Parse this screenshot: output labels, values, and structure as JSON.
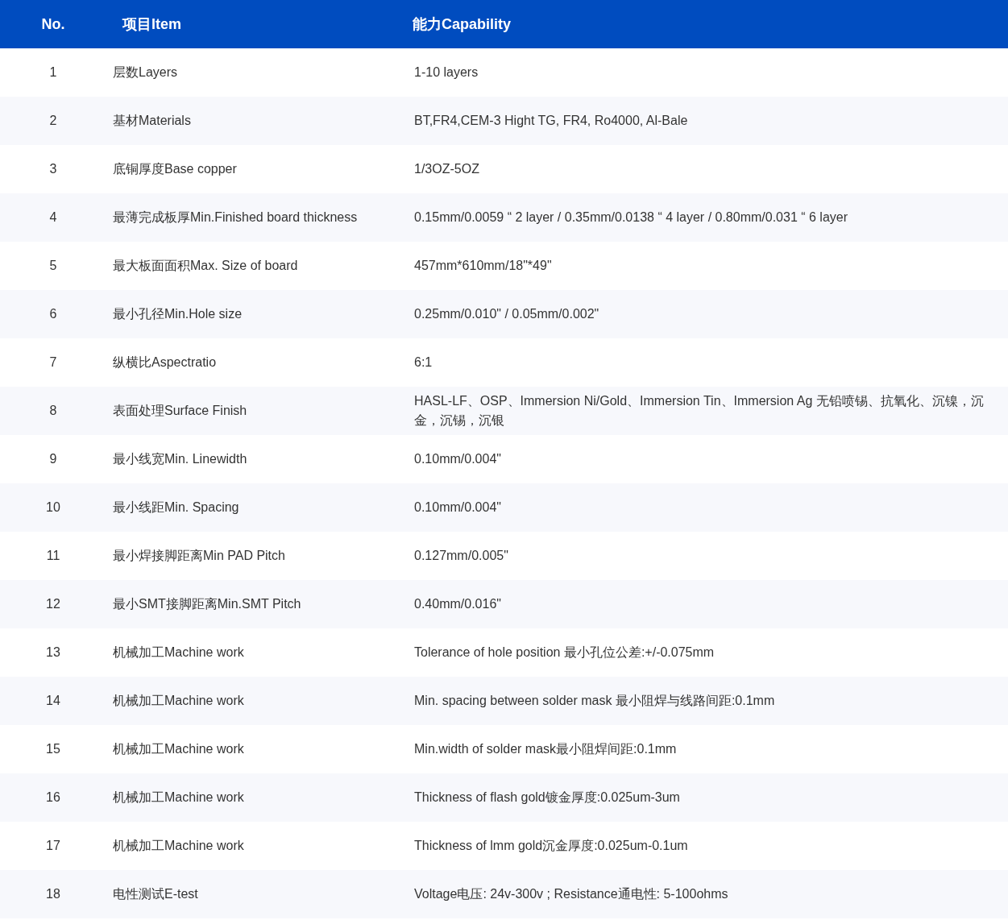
{
  "table": {
    "columns": [
      "No.",
      "项目Item",
      "能力Capability"
    ],
    "rows": [
      {
        "no": "1",
        "item": "层数Layers",
        "capability": "1-10 layers"
      },
      {
        "no": "2",
        "item": "基材Materials",
        "capability": "BT,FR4,CEM-3 Hight TG, FR4, Ro4000,  Al-Bale"
      },
      {
        "no": "3",
        "item": "底铜厚度Base copper",
        "capability": "1/3OZ-5OZ"
      },
      {
        "no": "4",
        "item": "最薄完成板厚Min.Finished board thickness",
        "capability": "0.15mm/0.0059 “ 2 layer / 0.35mm/0.0138 “ 4 layer / 0.80mm/0.031 “  6 layer"
      },
      {
        "no": "5",
        "item": "最大板面面积Max. Size of board",
        "capability": "457mm*610mm/18\"*49\""
      },
      {
        "no": "6",
        "item": "最小孔径Min.Hole size",
        "capability": "0.25mm/0.010\" / 0.05mm/0.002\""
      },
      {
        "no": "7",
        "item": "纵横比Aspectratio",
        "capability": "6:1"
      },
      {
        "no": "8",
        "item": "表面处理Surface Finish",
        "capability": "HASL-LF、OSP、Immersion Ni/Gold、Immersion Tin、Immersion Ag 无铅喷锡、抗氧化、沉镍，沉金，沉锡，沉银"
      },
      {
        "no": "9",
        "item": "最小线宽Min. Linewidth",
        "capability": "0.10mm/0.004\""
      },
      {
        "no": "10",
        "item": "最小线距Min. Spacing",
        "capability": "0.10mm/0.004\""
      },
      {
        "no": "11",
        "item": "最小焊接脚距离Min PAD Pitch",
        "capability": "0.127mm/0.005\""
      },
      {
        "no": "12",
        "item": "最小SMT接脚距离Min.SMT Pitch",
        "capability": "0.40mm/0.016\""
      },
      {
        "no": "13",
        "item": "机械加工Machine work",
        "capability": "Tolerance of hole position 最小孔位公差:+/-0.075mm"
      },
      {
        "no": "14",
        "item": "机械加工Machine work",
        "capability": "Min. spacing between solder mask  最小阻焊与线路间距:0.1mm"
      },
      {
        "no": "15",
        "item": "机械加工Machine work",
        "capability": "Min.width of solder mask最小阻焊间距:0.1mm"
      },
      {
        "no": "16",
        "item": "机械加工Machine work",
        "capability": "Thickness of flash gold镀金厚度:0.025um-3um"
      },
      {
        "no": "17",
        "item": "机械加工Machine work",
        "capability": "Thickness of lmm gold沉金厚度:0.025um-0.1um"
      },
      {
        "no": "18",
        "item": "电性测试E-test",
        "capability": "Voltage电压: 24v-300v ; Resistance通电性: 5-100ohms"
      }
    ]
  }
}
